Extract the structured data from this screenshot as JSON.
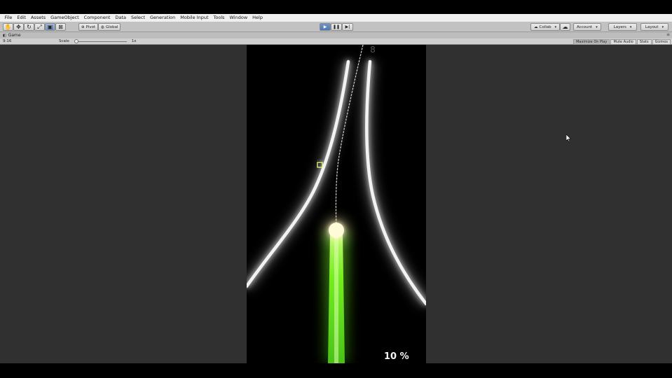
{
  "menu": [
    "File",
    "Edit",
    "Assets",
    "GameObject",
    "Component",
    "Data",
    "Select",
    "Generation",
    "Mobile Input",
    "Tools",
    "Window",
    "Help"
  ],
  "toolbar": {
    "pivot_label": "Pivot",
    "global_label": "Global",
    "collab_label": "Collab",
    "account_label": "Account",
    "layers_label": "Layers",
    "layout_label": "Layout"
  },
  "tab": {
    "game_label": "Game"
  },
  "gamebar": {
    "aspect": "9:16",
    "scale_label": "Scale",
    "scale_value": "1x",
    "maximize_label": "Maximize On Play",
    "mute_label": "Mute Audio",
    "stats_label": "Stats",
    "gizmos_label": "Gizmos"
  },
  "game": {
    "score": "8",
    "progress": "10 %",
    "ball_color": "#fffbc8",
    "trail_color": "#8cff2a",
    "pickup_color": "#e8ff7a"
  }
}
